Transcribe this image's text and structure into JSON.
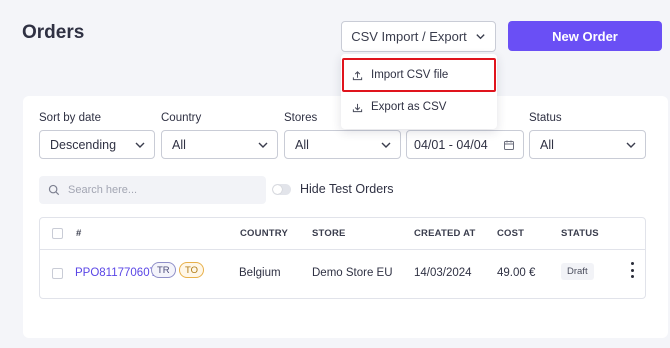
{
  "header": {
    "title": "Orders",
    "csv_button": "CSV Import / Export",
    "new_order": "New Order"
  },
  "csv_menu": {
    "items": [
      {
        "label": "Import CSV file",
        "icon": "upload-icon",
        "highlighted": true
      },
      {
        "label": "Export as CSV",
        "icon": "download-icon"
      }
    ]
  },
  "filters": {
    "sort": {
      "label": "Sort by date",
      "value": "Descending"
    },
    "country": {
      "label": "Country",
      "value": "All"
    },
    "stores": {
      "label": "Stores",
      "value": "All"
    },
    "date": {
      "value": "04/01 - 04/04"
    },
    "status": {
      "label": "Status",
      "value": "All"
    }
  },
  "search": {
    "placeholder": "Search here..."
  },
  "toggle": {
    "label": "Hide Test Orders",
    "on": false
  },
  "table": {
    "columns": [
      "#",
      "COUNTRY",
      "STORE",
      "CREATED AT",
      "COST",
      "STATUS"
    ],
    "rows": [
      {
        "order_id": "PPO81177060T",
        "tags": [
          "TR",
          "TO"
        ],
        "country": "Belgium",
        "store": "Demo Store EU",
        "created_at": "14/03/2024",
        "cost": "49.00 €",
        "status": "Draft"
      }
    ]
  },
  "colors": {
    "accent": "#6a4ff5",
    "highlight": "#e0141d",
    "background": "#f4f5f9"
  }
}
